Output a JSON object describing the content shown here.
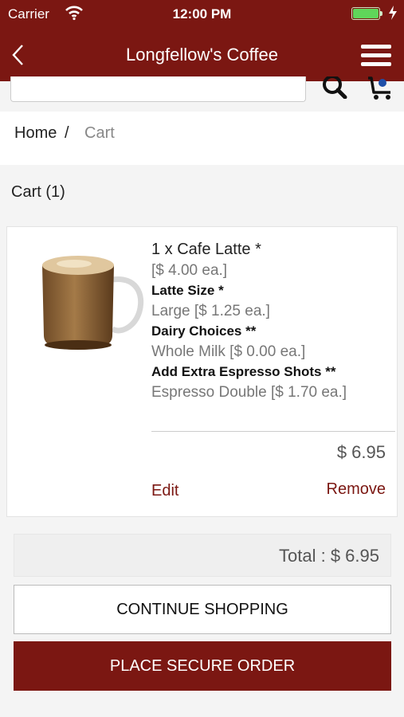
{
  "status_bar": {
    "carrier": "Carrier",
    "time": "12:00 PM",
    "battery_level": 1.0
  },
  "nav": {
    "title": "Longfellow's Coffee",
    "back_icon": "chevron-left-icon",
    "menu_icon": "hamburger-menu-icon",
    "background": "#7b1712"
  },
  "search": {
    "search_icon": "search-icon",
    "cart_icon": "cart-icon"
  },
  "breadcrumb": {
    "home": "Home",
    "separator": "/",
    "current": "Cart"
  },
  "cart": {
    "heading": "Cart (1)",
    "items": [
      {
        "name": "1 x Cafe Latte *",
        "unit_price": "[$ 4.00 ea.]",
        "options": [
          {
            "label": "Latte Size *",
            "value": "Large [$ 1.25 ea.]"
          },
          {
            "label": "Dairy Choices **",
            "value": "Whole Milk [$ 0.00 ea.]"
          },
          {
            "label": "Add Extra Espresso Shots **",
            "value": "Espresso Double [$ 1.70 ea.]"
          }
        ],
        "subtotal": "$ 6.95",
        "edit_label": "Edit",
        "remove_label": "Remove"
      }
    ],
    "total": "Total : $ 6.95",
    "continue_label": "CONTINUE SHOPPING",
    "order_label": "PLACE SECURE ORDER"
  }
}
